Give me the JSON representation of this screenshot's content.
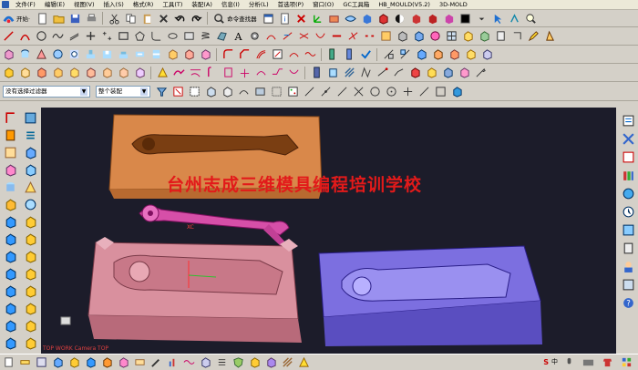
{
  "menubar": {
    "items": [
      {
        "label": "文件(F)"
      },
      {
        "label": "编辑(E)"
      },
      {
        "label": "视图(V)"
      },
      {
        "label": "插入(S)"
      },
      {
        "label": "格式(R)"
      },
      {
        "label": "工具(T)"
      },
      {
        "label": "装配(A)"
      },
      {
        "label": "信息(I)"
      },
      {
        "label": "分析(L)"
      },
      {
        "label": "首选项(P)"
      },
      {
        "label": "窗口(O)"
      },
      {
        "label": "GC工具箱"
      },
      {
        "label": "HB_MOULD(V5.2)"
      },
      {
        "label": "3D-MOLD"
      }
    ]
  },
  "standard_toolbar": {
    "start_label": "开始·",
    "command_finder_label": "命令查找器"
  },
  "selection_bar": {
    "filter_value": "没有选择过滤器",
    "scope_value": "整个装配"
  },
  "viewport": {
    "watermark": "台州志成三维模具编程培训学校",
    "view_label": "TOP WORK Camera TOP",
    "axis_label": "XC"
  },
  "tray": {
    "ime_label": "S",
    "extra_label": "中"
  },
  "colors": {
    "background": "#1c1c2a",
    "core_plate": "#d9884a",
    "part": "#d64fa8",
    "insert_plate": "#d9909e",
    "cavity_plate": "#7c6fe0",
    "watermark": "#e21a1a"
  }
}
